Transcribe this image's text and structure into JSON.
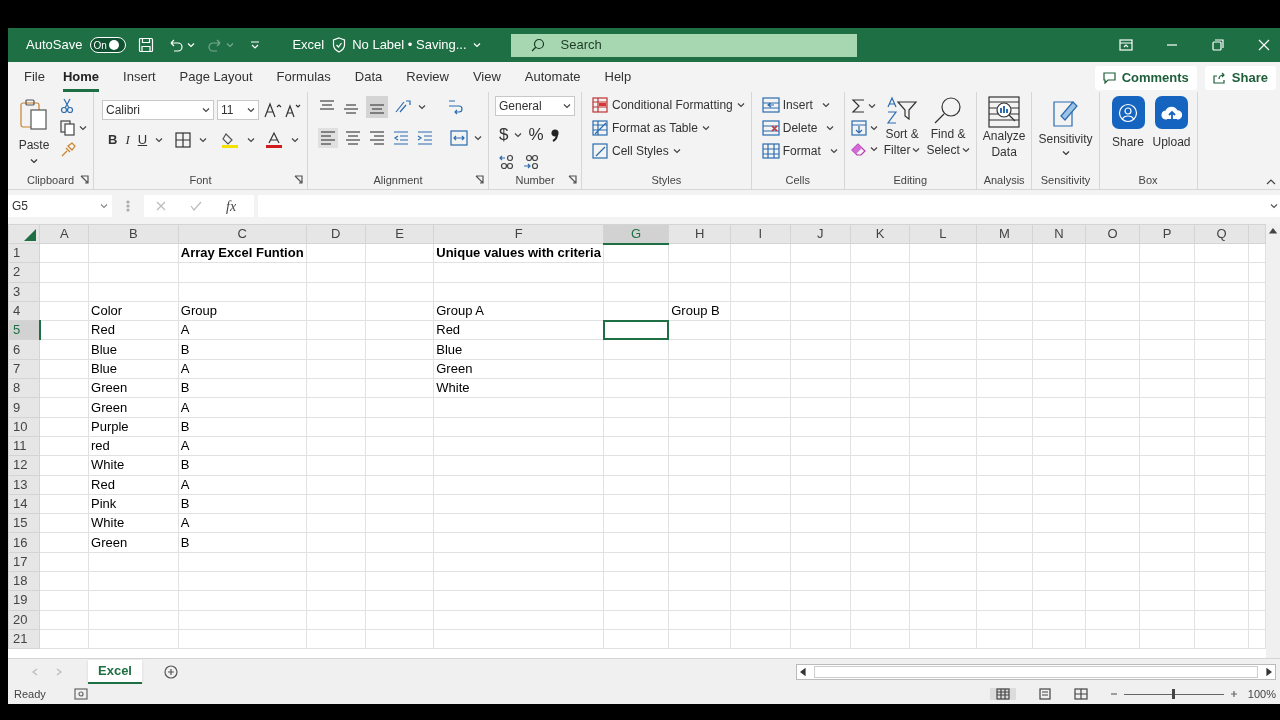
{
  "title_bar": {
    "autosave": {
      "label": "AutoSave",
      "toggle": "On",
      "on": true
    },
    "file_name": "Excel",
    "sensitivity_label": "No Label • Saving...",
    "search": {
      "placeholder": "Search"
    }
  },
  "tabs": [
    {
      "label": "File",
      "selected": false
    },
    {
      "label": "Home",
      "selected": true
    },
    {
      "label": "Insert",
      "selected": false
    },
    {
      "label": "Page Layout",
      "selected": false
    },
    {
      "label": "Formulas",
      "selected": false
    },
    {
      "label": "Data",
      "selected": false
    },
    {
      "label": "Review",
      "selected": false
    },
    {
      "label": "View",
      "selected": false
    },
    {
      "label": "Automate",
      "selected": false
    },
    {
      "label": "Help",
      "selected": false
    }
  ],
  "header_buttons": [
    "Comments",
    "Share"
  ],
  "ribbon": {
    "clipboard": {
      "label": "Clipboard",
      "paste": "Paste"
    },
    "font": {
      "label": "Font",
      "font_name": "Calibri",
      "font_size": "11",
      "bold": "B",
      "italic": "I",
      "underline": "U"
    },
    "alignment": {
      "label": "Alignment"
    },
    "number": {
      "label": "Number",
      "format": "General",
      "currency": "$",
      "percent": "%"
    },
    "styles": {
      "label": "Styles",
      "items": [
        "Conditional Formatting",
        "Format as Table",
        "Cell Styles"
      ]
    },
    "cells": {
      "label": "Cells",
      "items": [
        "Insert",
        "Delete",
        "Format"
      ]
    },
    "editing": {
      "label": "Editing",
      "sort": [
        "Sort &",
        "Filter"
      ],
      "find": [
        "Find &",
        "Select"
      ]
    },
    "analysis": {
      "label": "Analysis",
      "button": [
        "Analyze",
        "Data"
      ]
    },
    "sensitivity": {
      "label": "Sensitivity",
      "button": "Sensitivity"
    },
    "box": {
      "label": "Box",
      "buttons": [
        "Share",
        "Upload"
      ]
    }
  },
  "formula_bar": {
    "name_box": "G5",
    "function": "fx"
  },
  "columns": [
    {
      "label": "A",
      "selected": false
    },
    {
      "label": "B",
      "selected": false
    },
    {
      "label": "C",
      "selected": false
    },
    {
      "label": "D",
      "selected": false
    },
    {
      "label": "E",
      "selected": false
    },
    {
      "label": "F",
      "selected": false
    },
    {
      "label": "G",
      "selected": true
    },
    {
      "label": "H",
      "selected": false
    },
    {
      "label": "I",
      "selected": false
    },
    {
      "label": "J",
      "selected": false
    },
    {
      "label": "K",
      "selected": false
    },
    {
      "label": "L",
      "selected": false
    },
    {
      "label": "M",
      "selected": false
    },
    {
      "label": "N",
      "selected": false
    },
    {
      "label": "O",
      "selected": false
    },
    {
      "label": "P",
      "selected": false
    },
    {
      "label": "Q",
      "selected": false
    }
  ],
  "rows": [
    {
      "label": "1",
      "selected": false,
      "cells": {
        "C": {
          "text": "Array Excel Funtion",
          "bold": true
        },
        "F": {
          "text": "Unique values with criteria",
          "bold": true
        }
      }
    },
    {
      "label": "2",
      "selected": false,
      "cells": {}
    },
    {
      "label": "3",
      "selected": false,
      "cells": {}
    },
    {
      "label": "4",
      "selected": false,
      "cells": {
        "B": {
          "text": "Color"
        },
        "C": {
          "text": "Group"
        },
        "F": {
          "text": "Group A"
        },
        "H": {
          "text": "Group B"
        }
      }
    },
    {
      "label": "5",
      "selected": true,
      "cells": {
        "B": {
          "text": "Red"
        },
        "C": {
          "text": "A"
        },
        "F": {
          "text": "Red"
        }
      }
    },
    {
      "label": "6",
      "selected": false,
      "cells": {
        "B": {
          "text": "Blue"
        },
        "C": {
          "text": "B"
        },
        "F": {
          "text": "Blue"
        }
      }
    },
    {
      "label": "7",
      "selected": false,
      "cells": {
        "B": {
          "text": "Blue"
        },
        "C": {
          "text": "A"
        },
        "F": {
          "text": "Green"
        }
      }
    },
    {
      "label": "8",
      "selected": false,
      "cells": {
        "B": {
          "text": "Green"
        },
        "C": {
          "text": "B"
        },
        "F": {
          "text": "White"
        }
      }
    },
    {
      "label": "9",
      "selected": false,
      "cells": {
        "B": {
          "text": "Green"
        },
        "C": {
          "text": "A"
        }
      }
    },
    {
      "label": "10",
      "selected": false,
      "cells": {
        "B": {
          "text": "Purple"
        },
        "C": {
          "text": "B"
        }
      }
    },
    {
      "label": "11",
      "selected": false,
      "cells": {
        "B": {
          "text": "red"
        },
        "C": {
          "text": "A"
        }
      }
    },
    {
      "label": "12",
      "selected": false,
      "cells": {
        "B": {
          "text": "White"
        },
        "C": {
          "text": "B"
        }
      }
    },
    {
      "label": "13",
      "selected": false,
      "cells": {
        "B": {
          "text": "Red"
        },
        "C": {
          "text": "A"
        }
      }
    },
    {
      "label": "14",
      "selected": false,
      "cells": {
        "B": {
          "text": "Pink"
        },
        "C": {
          "text": "B"
        }
      }
    },
    {
      "label": "15",
      "selected": false,
      "cells": {
        "B": {
          "text": "White"
        },
        "C": {
          "text": "A"
        }
      }
    },
    {
      "label": "16",
      "selected": false,
      "cells": {
        "B": {
          "text": "Green"
        },
        "C": {
          "text": "B"
        }
      }
    },
    {
      "label": "17",
      "selected": false,
      "cells": {}
    },
    {
      "label": "18",
      "selected": false,
      "cells": {}
    },
    {
      "label": "19",
      "selected": false,
      "cells": {}
    },
    {
      "label": "20",
      "selected": false,
      "cells": {}
    },
    {
      "label": "21",
      "selected": false,
      "cells": {}
    }
  ],
  "sheet_tabs": [
    {
      "label": "Excel",
      "selected": true
    }
  ],
  "status_bar": {
    "status": "Ready",
    "zoom_slider": {
      "level": 0.5
    },
    "zoom": "100%"
  }
}
